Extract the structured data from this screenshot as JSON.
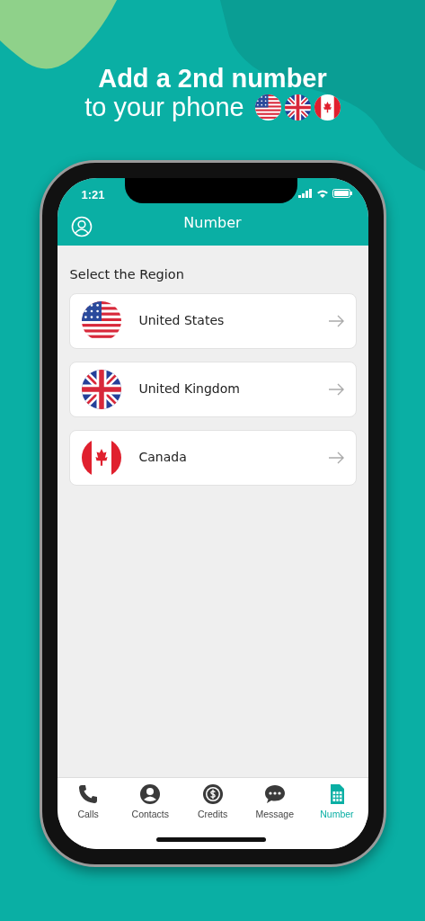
{
  "headline": {
    "title": "Add a 2nd number",
    "subtitle": "to your phone",
    "flags": [
      {
        "kind": "us"
      },
      {
        "kind": "uk"
      },
      {
        "kind": "ca"
      }
    ]
  },
  "status_bar": {
    "time": "1:21"
  },
  "header": {
    "title": "Number"
  },
  "section_label": "Select the Region",
  "regions": [
    {
      "name": "United States",
      "kind": "us"
    },
    {
      "name": "United Kingdom",
      "kind": "uk"
    },
    {
      "name": "Canada",
      "kind": "ca"
    }
  ],
  "tabs": [
    {
      "label": "Calls",
      "kind": "calls",
      "selected": false
    },
    {
      "label": "Contacts",
      "kind": "contacts",
      "selected": false
    },
    {
      "label": "Credits",
      "kind": "credits",
      "selected": false
    },
    {
      "label": "Message",
      "kind": "message",
      "selected": false
    },
    {
      "label": "Number",
      "kind": "number",
      "selected": true
    }
  ]
}
